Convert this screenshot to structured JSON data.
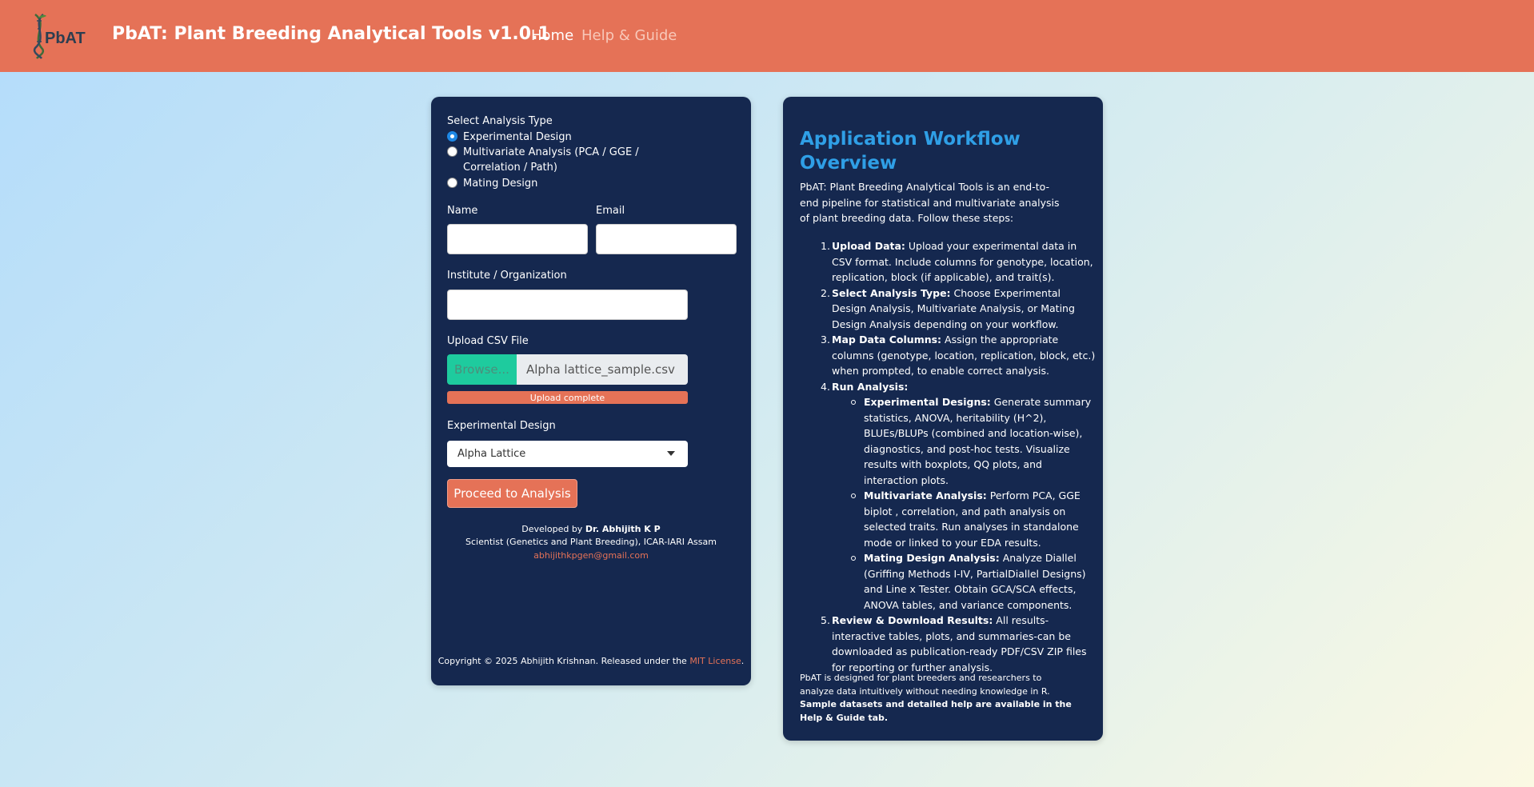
{
  "navbar": {
    "logo_text": "PbAT",
    "title": "PbAT: Plant Breeding Analytical Tools v1.0.1",
    "home": "Home",
    "help": "Help & Guide",
    "bg_color": "#e57257"
  },
  "form": {
    "analysis_label": "Select Analysis Type",
    "options": [
      "Experimental Design",
      "Multivariate Analysis (PCA / GGE / Correlation / Path)",
      "Mating Design"
    ],
    "selected_option": "Experimental Design",
    "name_label": "Name",
    "name_value": "",
    "email_label": "Email",
    "email_value": "",
    "institute_label": "Institute / Organization",
    "institute_value": "",
    "upload_label": "Upload CSV File",
    "browse_label": "Browse...",
    "file_name": "Alpha lattice_sample.csv",
    "upload_status": "Upload complete",
    "upload_progress": 1.0,
    "design_label": "Experimental Design",
    "design_selected": "Alpha Lattice",
    "proceed_label": "Proceed to Analysis"
  },
  "developer": {
    "prefix": "Developed by ",
    "name": "Dr. Abhijith K P",
    "role": "Scientist (Genetics and Plant Breeding), ICAR-IARI Assam",
    "email": "abhijithkpgen@gmail.com"
  },
  "copyright": {
    "text": "Copyright © 2025 Abhijith Krishnan. Released under the ",
    "license": "MIT License",
    "end": "."
  },
  "workflow": {
    "title": "Application Workflow Overview",
    "intro": "PbAT: Plant Breeding Analytical Tools is an end-to-end pipeline for statistical and multivariate analysis of plant breeding data. Follow these steps:",
    "steps": [
      {
        "num": "1.",
        "head": "Upload Data:",
        "text": " Upload your experimental data in CSV format. Include columns for genotype, location, replication, block (if applicable), and trait(s)."
      },
      {
        "num": "2.",
        "head": "Select Analysis Type:",
        "text": " Choose Experimental Design Analysis, Multivariate Analysis, or Mating Design Analysis depending on your workflow."
      },
      {
        "num": "3.",
        "head": "Map Data Columns:",
        "text": " Assign the appropriate columns (genotype, location, replication, block, etc.) when prompted, to enable correct analysis."
      },
      {
        "num": "4.",
        "head": "Run Analysis:",
        "text": ""
      },
      {
        "num": "5.",
        "head": "Review & Download Results:",
        "text": " All results-interactive tables, plots, and summaries-can be downloaded as publication-ready PDF/CSV ZIP files for reporting or further analysis."
      }
    ],
    "substeps": [
      {
        "head": "Experimental Designs:",
        "text": " Generate summary statistics, ANOVA, heritability (H^2), BLUEs/BLUPs (combined and location-wise), diagnostics, and post-hoc tests. Visualize results with boxplots, QQ plots, and interaction plots."
      },
      {
        "head": "Multivariate Analysis:",
        "text": " Perform PCA, GGE biplot , correlation, and path analysis on selected traits. Run analyses in standalone mode or linked to your EDA results."
      },
      {
        "head": "Mating Design Analysis:",
        "text": " Analyze Diallel (Griffing Methods I-IV, PartialDiallel Designs) and Line x Tester. Obtain GCA/SCA effects, ANOVA tables, and variance components."
      }
    ],
    "footer_text": "PbAT is designed for plant breeders and researchers to analyze data intuitively without needing knowledge in R. ",
    "footer_bold": "Sample datasets and detailed help are available in the Help & Guide tab."
  }
}
